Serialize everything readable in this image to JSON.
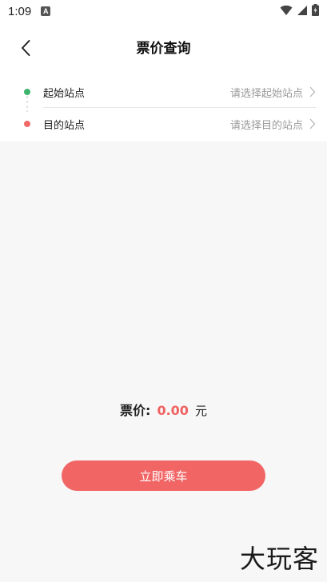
{
  "status_bar": {
    "time": "1:09",
    "notification_badge": "A"
  },
  "header": {
    "title": "票价查询"
  },
  "stations": {
    "start": {
      "label": "起始站点",
      "placeholder": "请选择起始站点"
    },
    "end": {
      "label": "目的站点",
      "placeholder": "请选择目的站点"
    }
  },
  "fare": {
    "label": "票价:",
    "value": "0.00",
    "unit": "元"
  },
  "actions": {
    "ride_label": "立即乘车"
  },
  "watermark": "大玩客",
  "colors": {
    "accent": "#f26565",
    "start_dot": "#3db36b",
    "end_dot": "#f06868"
  }
}
